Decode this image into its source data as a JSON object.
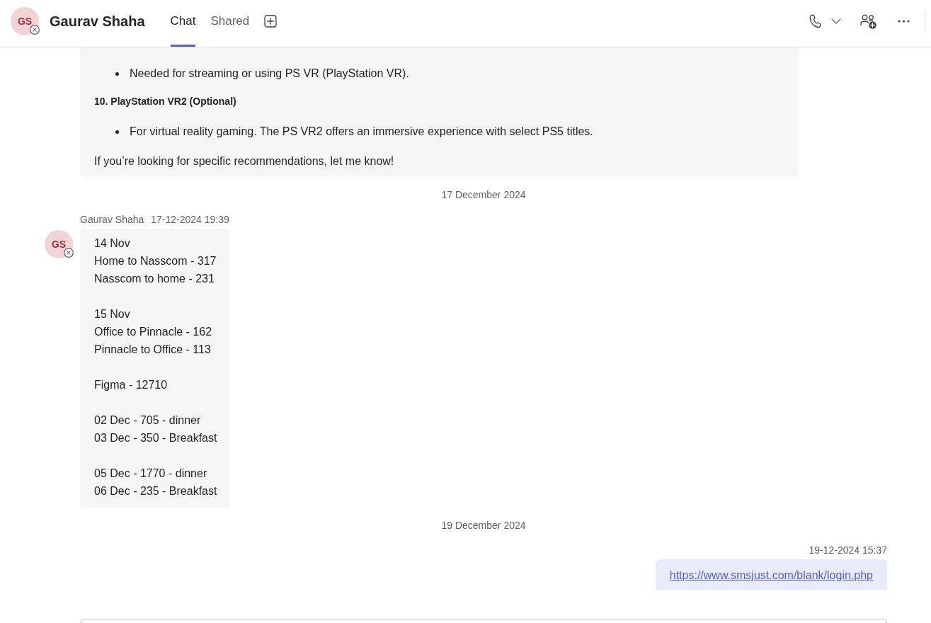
{
  "header": {
    "avatar": {
      "initials": "GS"
    },
    "title": "Gaurav Shaha",
    "tabs": [
      {
        "label": "Chat",
        "selected": true
      },
      {
        "label": "Shared",
        "selected": false
      }
    ]
  },
  "messages": [
    {
      "kind": "received",
      "blocks": [
        {
          "kind": "bullets",
          "items": [
            "Needed for streaming or using PS VR (PlayStation VR)."
          ]
        },
        {
          "kind": "heading",
          "text": "10. PlayStation VR2 (Optional)"
        },
        {
          "kind": "bullets",
          "items": [
            "For virtual reality gaming. The PS VR2 offers an immersive experience with select PS5 titles."
          ]
        },
        {
          "kind": "paragraph",
          "text": "If you’re looking for specific recommendations, let me know!"
        }
      ]
    },
    {
      "kind": "date",
      "text": "17 December 2024"
    },
    {
      "kind": "received",
      "sender": "Gaurav Shaha",
      "time": "17-12-2024 19:39",
      "avatar": {
        "initials": "GS"
      },
      "blocks": [
        {
          "kind": "lines",
          "lines": [
            "14 Nov",
            "Home to Nasscom - 317",
            "Nasscom to home - 231"
          ]
        },
        {
          "kind": "lines",
          "lines": [
            "15 Nov",
            "Office to Pinnacle - 162",
            "Pinnacle to Office - 113"
          ]
        },
        {
          "kind": "lines",
          "lines": [
            "Figma - 12710"
          ]
        },
        {
          "kind": "lines",
          "lines": [
            "02 Dec - 705 - dinner",
            "03 Dec - 350 - Breakfast"
          ]
        },
        {
          "kind": "lines",
          "lines": [
            "05 Dec - 1770 - dinner",
            "06 Dec - 235 - Breakfast"
          ]
        }
      ]
    },
    {
      "kind": "date",
      "text": "19 December 2024"
    },
    {
      "kind": "sent",
      "time": "19-12-2024 15:37",
      "blocks": [
        {
          "kind": "link",
          "text": "https://www.smsjust.com/blank/login.php"
        }
      ]
    }
  ]
}
